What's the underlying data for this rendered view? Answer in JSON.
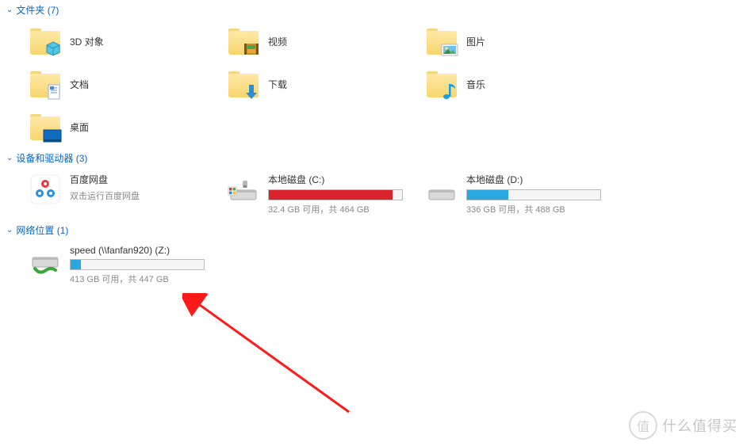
{
  "sections": {
    "folders": {
      "title": "文件夹 (7)",
      "items": [
        {
          "name": "3D 对象"
        },
        {
          "name": "视频"
        },
        {
          "name": "图片"
        },
        {
          "name": "文档"
        },
        {
          "name": "下载"
        },
        {
          "name": "音乐"
        },
        {
          "name": "桌面"
        }
      ]
    },
    "devices": {
      "title": "设备和驱动器 (3)",
      "baidu": {
        "name": "百度网盘",
        "hint": "双击运行百度网盘"
      },
      "driveC": {
        "name": "本地磁盘 (C:)",
        "info": "32.4 GB 可用，共 464 GB",
        "fill": 93,
        "color": "red"
      },
      "driveD": {
        "name": "本地磁盘 (D:)",
        "info": "336 GB 可用，共 488 GB",
        "fill": 31,
        "color": "blue"
      }
    },
    "network": {
      "title": "网络位置 (1)",
      "driveZ": {
        "name": "speed (\\\\fanfan920) (Z:)",
        "info": "413 GB 可用，共 447 GB",
        "fill": 8,
        "color": "blue"
      }
    }
  },
  "watermark": {
    "badge": "值",
    "text": "什么值得买"
  }
}
